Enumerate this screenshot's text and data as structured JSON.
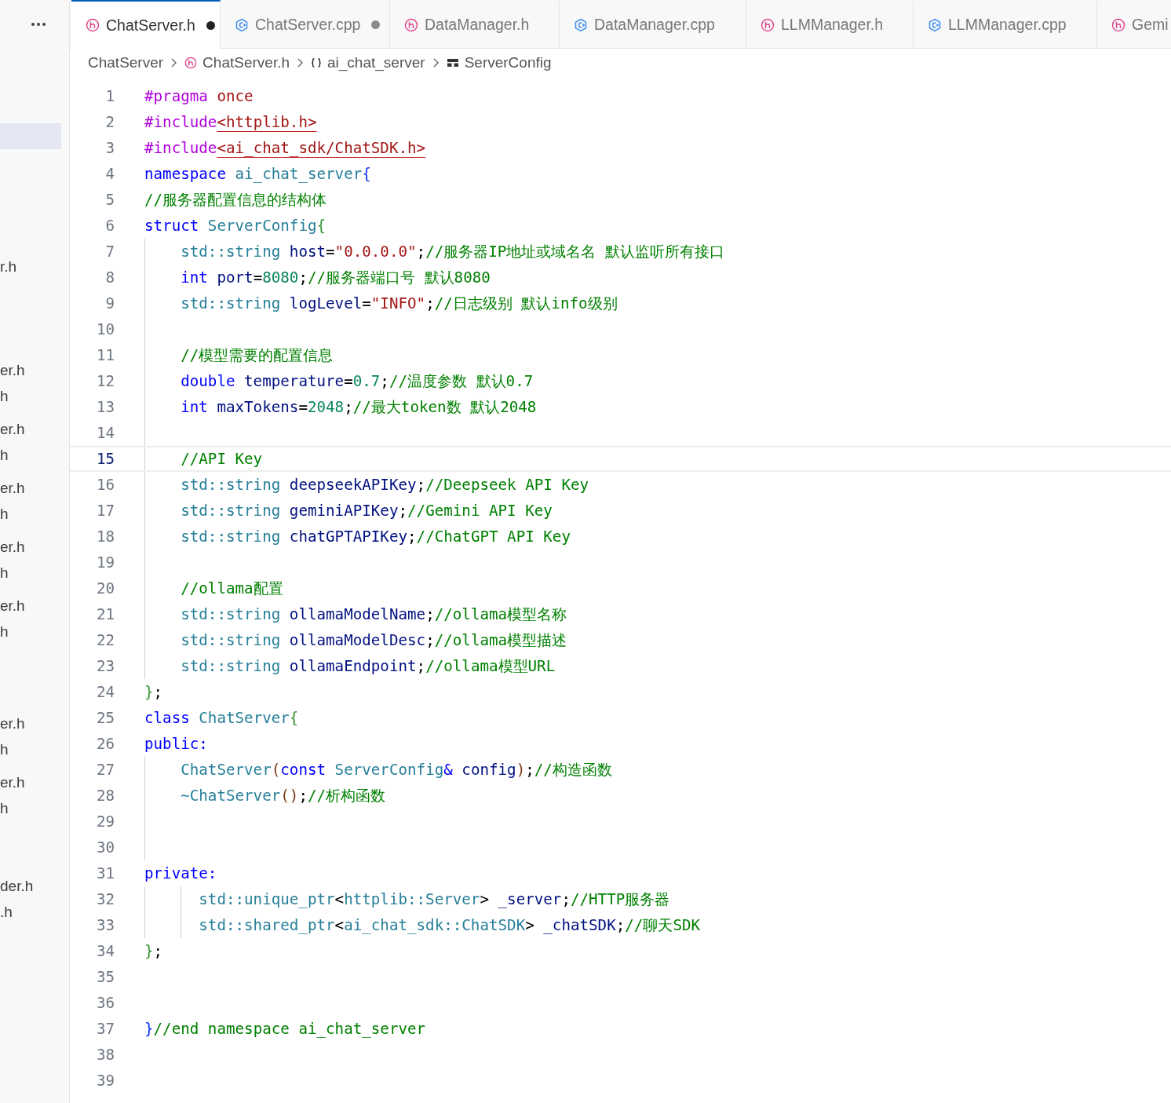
{
  "explorer": {
    "items": [
      {
        "selected": true
      },
      {
        "label": "r.h",
        "selected": false
      },
      {
        "label": "er.h",
        "selected": false
      },
      {
        "label": "h",
        "selected": false
      },
      {
        "label": "er.h",
        "selected": false
      },
      {
        "label": "h",
        "selected": false
      },
      {
        "label": "er.h",
        "selected": false
      },
      {
        "label": "h",
        "selected": false
      },
      {
        "label": "er.h",
        "selected": false
      },
      {
        "label": "h",
        "selected": false
      },
      {
        "label": "er.h",
        "selected": false
      },
      {
        "label": "h",
        "selected": false
      },
      {
        "label": "er.h",
        "selected": false
      },
      {
        "label": "h",
        "selected": false
      },
      {
        "label": "er.h",
        "selected": false
      },
      {
        "label": "h",
        "selected": false
      },
      {
        "label": "der.h",
        "selected": false
      },
      {
        "label": ".h",
        "selected": false
      }
    ]
  },
  "tabs": [
    {
      "label": "ChatServer.h",
      "kind": "header",
      "selected": true,
      "dirty": true
    },
    {
      "label": "ChatServer.cpp",
      "kind": "source",
      "selected": false,
      "dirty": true
    },
    {
      "label": "DataManager.h",
      "kind": "header",
      "selected": false,
      "dirty": false
    },
    {
      "label": "DataManager.cpp",
      "kind": "source",
      "selected": false,
      "dirty": false
    },
    {
      "label": "LLMManager.h",
      "kind": "header",
      "selected": false,
      "dirty": false
    },
    {
      "label": "LLMManager.cpp",
      "kind": "source",
      "selected": false,
      "dirty": false
    },
    {
      "label": "Gemi",
      "kind": "header",
      "selected": false
    }
  ],
  "breadcrumb": [
    {
      "label": "ChatServer",
      "kind": "folder"
    },
    {
      "label": "ChatServer.h",
      "kind": "header"
    },
    {
      "label": "ai_chat_server",
      "kind": "namespace"
    },
    {
      "label": "ServerConfig",
      "kind": "struct"
    }
  ],
  "editor": {
    "lines": [
      {
        "number": "1",
        "current": false,
        "tokens": [
          {
            "kind": "pre",
            "text": "#pragma"
          },
          {
            "kind": "str",
            "text": " once"
          }
        ]
      },
      {
        "number": "2",
        "current": false,
        "tokens": [
          {
            "kind": "pre",
            "text": "#include"
          },
          {
            "kind": "inc",
            "text": "<httplib.h>"
          }
        ]
      },
      {
        "number": "3",
        "current": false,
        "tokens": [
          {
            "kind": "pre",
            "text": "#include"
          },
          {
            "kind": "inc",
            "text": "<ai_chat_sdk/ChatSDK.h>"
          }
        ]
      },
      {
        "number": "4",
        "current": false,
        "tokens": [
          {
            "kind": "kw",
            "text": "namespace"
          },
          {
            "kind": "type",
            "text": " ai_chat_server"
          },
          {
            "kind": "b1",
            "text": "{"
          }
        ]
      },
      {
        "number": "5",
        "current": false,
        "tokens": [
          {
            "kind": "com",
            "text": "//服务器配置信息的结构体"
          }
        ]
      },
      {
        "number": "6",
        "current": false,
        "tokens": [
          {
            "kind": "kw",
            "text": "struct"
          },
          {
            "kind": "type",
            "text": " ServerConfig"
          },
          {
            "kind": "b2",
            "text": "{"
          }
        ],
        "children": [
          {
            "number": "7",
            "current": false,
            "tokens": [
              {
                "kind": "type",
                "text": "std::string"
              },
              {
                "kind": "var",
                "text": " host"
              },
              {
                "kind": "plain",
                "text": "="
              },
              {
                "kind": "str",
                "text": "\"0.0.0.0\""
              },
              {
                "kind": "plain",
                "text": ";"
              },
              {
                "kind": "com",
                "text": "//服务器IP地址或域名名 默认监听所有接口"
              }
            ]
          },
          {
            "number": "8",
            "current": false,
            "tokens": [
              {
                "kind": "kw",
                "text": "int"
              },
              {
                "kind": "var",
                "text": " port"
              },
              {
                "kind": "plain",
                "text": "="
              },
              {
                "kind": "num",
                "text": "8080"
              },
              {
                "kind": "plain",
                "text": ";"
              },
              {
                "kind": "com",
                "text": "//服务器端口号 默认8080"
              }
            ]
          },
          {
            "number": "9",
            "current": false,
            "tokens": [
              {
                "kind": "type",
                "text": "std::string"
              },
              {
                "kind": "var",
                "text": " logLevel"
              },
              {
                "kind": "plain",
                "text": "="
              },
              {
                "kind": "str",
                "text": "\"INFO\""
              },
              {
                "kind": "plain",
                "text": ";"
              },
              {
                "kind": "com",
                "text": "//日志级别 默认info级别"
              }
            ]
          },
          {
            "number": "10",
            "current": false
          },
          {
            "number": "11",
            "current": false,
            "tokens": [
              {
                "kind": "com",
                "text": "//模型需要的配置信息"
              }
            ]
          },
          {
            "number": "12",
            "current": false,
            "tokens": [
              {
                "kind": "kw",
                "text": "double"
              },
              {
                "kind": "var",
                "text": " temperature"
              },
              {
                "kind": "plain",
                "text": "="
              },
              {
                "kind": "num",
                "text": "0.7"
              },
              {
                "kind": "plain",
                "text": ";"
              },
              {
                "kind": "com",
                "text": "//温度参数 默认0.7"
              }
            ]
          },
          {
            "number": "13",
            "current": false,
            "tokens": [
              {
                "kind": "kw",
                "text": "int"
              },
              {
                "kind": "var",
                "text": " maxTokens"
              },
              {
                "kind": "plain",
                "text": "="
              },
              {
                "kind": "num",
                "text": "2048"
              },
              {
                "kind": "plain",
                "text": ";"
              },
              {
                "kind": "com",
                "text": "//最大token数 默认2048"
              }
            ]
          },
          {
            "number": "14",
            "current": false
          },
          {
            "number": "15",
            "current": true,
            "tokens": [
              {
                "kind": "com",
                "text": "//API Key"
              }
            ]
          },
          {
            "number": "16",
            "current": false,
            "tokens": [
              {
                "kind": "type",
                "text": "std::string"
              },
              {
                "kind": "var",
                "text": " deepseekAPIKey"
              },
              {
                "kind": "plain",
                "text": ";"
              },
              {
                "kind": "com",
                "text": "//Deepseek API Key"
              }
            ]
          },
          {
            "number": "17",
            "current": false,
            "tokens": [
              {
                "kind": "type",
                "text": "std::string"
              },
              {
                "kind": "var",
                "text": " geminiAPIKey"
              },
              {
                "kind": "plain",
                "text": ";"
              },
              {
                "kind": "com",
                "text": "//Gemini API Key"
              }
            ]
          },
          {
            "number": "18",
            "current": false,
            "tokens": [
              {
                "kind": "type",
                "text": "std::string"
              },
              {
                "kind": "var",
                "text": " chatGPTAPIKey"
              },
              {
                "kind": "plain",
                "text": ";"
              },
              {
                "kind": "com",
                "text": "//ChatGPT API Key"
              }
            ]
          },
          {
            "number": "19",
            "current": false
          },
          {
            "number": "20",
            "current": false,
            "tokens": [
              {
                "kind": "com",
                "text": "//ollama配置"
              }
            ]
          },
          {
            "number": "21",
            "current": false,
            "tokens": [
              {
                "kind": "type",
                "text": "std::string"
              },
              {
                "kind": "var",
                "text": " ollamaModelName"
              },
              {
                "kind": "plain",
                "text": ";"
              },
              {
                "kind": "com",
                "text": "//ollama模型名称"
              }
            ]
          },
          {
            "number": "22",
            "current": false,
            "tokens": [
              {
                "kind": "type",
                "text": "std::string"
              },
              {
                "kind": "var",
                "text": " ollamaModelDesc"
              },
              {
                "kind": "plain",
                "text": ";"
              },
              {
                "kind": "com",
                "text": "//ollama模型描述"
              }
            ]
          },
          {
            "number": "23",
            "current": false,
            "tokens": [
              {
                "kind": "type",
                "text": "std::string"
              },
              {
                "kind": "var",
                "text": " ollamaEndpoint"
              },
              {
                "kind": "plain",
                "text": ";"
              },
              {
                "kind": "com",
                "text": "//ollama模型URL"
              }
            ]
          }
        ]
      },
      {
        "number": "24",
        "current": false,
        "tokens": [
          {
            "kind": "b2",
            "text": "}"
          },
          {
            "kind": "plain",
            "text": ";"
          }
        ]
      },
      {
        "number": "25",
        "current": false,
        "tokens": [
          {
            "kind": "kw",
            "text": "class"
          },
          {
            "kind": "type",
            "text": " ChatServer"
          },
          {
            "kind": "b2",
            "text": "{"
          }
        ]
      },
      {
        "number": "26",
        "current": false,
        "tokens": [
          {
            "kind": "kw",
            "text": "public:"
          }
        ],
        "children": [
          {
            "number": "27",
            "current": false,
            "tokens": [
              {
                "kind": "type",
                "text": "ChatServer"
              },
              {
                "kind": "b3",
                "text": "("
              },
              {
                "kind": "kw",
                "text": "const"
              },
              {
                "kind": "type",
                "text": " ServerConfig"
              },
              {
                "kind": "kw",
                "text": "&"
              },
              {
                "kind": "var",
                "text": " config"
              },
              {
                "kind": "b3",
                "text": ")"
              },
              {
                "kind": "plain",
                "text": ";"
              },
              {
                "kind": "com",
                "text": "//构造函数"
              }
            ]
          },
          {
            "number": "28",
            "current": false,
            "tokens": [
              {
                "kind": "type",
                "text": "~ChatServer"
              },
              {
                "kind": "b3",
                "text": "()"
              },
              {
                "kind": "plain",
                "text": ";"
              },
              {
                "kind": "com",
                "text": "//析构函数"
              }
            ]
          },
          {
            "number": "29",
            "current": false
          },
          {
            "number": "30",
            "current": false
          }
        ]
      },
      {
        "number": "31",
        "current": false,
        "tokens": [
          {
            "kind": "kw",
            "text": "private:"
          }
        ],
        "children": [
          {
            "children": [
              {
                "number": "32",
                "current": false,
                "tokens": [
                  {
                    "kind": "type",
                    "text": "std::unique_ptr"
                  },
                  {
                    "kind": "plain",
                    "text": "<"
                  },
                  {
                    "kind": "type",
                    "text": "httplib::Server"
                  },
                  {
                    "kind": "plain",
                    "text": ">"
                  },
                  {
                    "kind": "var",
                    "text": " _server"
                  },
                  {
                    "kind": "plain",
                    "text": ";"
                  },
                  {
                    "kind": "com",
                    "text": "//HTTP服务器"
                  }
                ]
              },
              {
                "number": "33",
                "current": false,
                "tokens": [
                  {
                    "kind": "type",
                    "text": "std::shared_ptr"
                  },
                  {
                    "kind": "plain",
                    "text": "<"
                  },
                  {
                    "kind": "type",
                    "text": "ai_chat_sdk::ChatSDK"
                  },
                  {
                    "kind": "plain",
                    "text": ">"
                  },
                  {
                    "kind": "var",
                    "text": " _chatSDK"
                  },
                  {
                    "kind": "plain",
                    "text": ";"
                  },
                  {
                    "kind": "com",
                    "text": "//聊天SDK"
                  }
                ]
              }
            ]
          }
        ]
      },
      {
        "number": "34",
        "current": false,
        "tokens": [
          {
            "kind": "b2",
            "text": "}"
          },
          {
            "kind": "plain",
            "text": ";"
          }
        ]
      },
      {
        "number": "35",
        "current": false
      },
      {
        "number": "36",
        "current": false
      },
      {
        "number": "37",
        "current": false,
        "tokens": [
          {
            "kind": "b1",
            "text": "}"
          },
          {
            "kind": "com",
            "text": "//end namespace ai_chat_server"
          }
        ]
      },
      {
        "number": "38",
        "current": false
      },
      {
        "number": "39",
        "current": false
      }
    ]
  }
}
